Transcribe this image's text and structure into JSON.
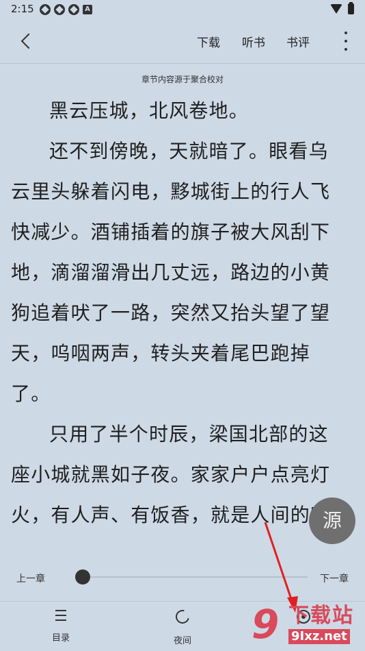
{
  "status_bar": {
    "time": "2:15",
    "notif_icon_letter": "A"
  },
  "toolbar": {
    "download_label": "下载",
    "listen_label": "听书",
    "review_label": "书评"
  },
  "source_note": "章节内容源于聚合校对",
  "content": {
    "paragraphs": [
      "黑云压城，北风卷地。",
      "还不到傍晚，天就暗了。眼看乌云里头躲着闪电，黟城街上的行人飞快减少。酒铺插着的旗子被大风刮下地，滴溜溜滑出几丈远，路边的小黄狗追着吠了一路，突然又抬头望了望天，呜咽两声，转头夹着尾巴跑掉了。",
      "只用了半个时辰，梁国北部的这座小城就黑如子夜。家家户户点亮灯火，有人声、有饭香，就是人间的味"
    ]
  },
  "source_button_label": "源",
  "progress": {
    "prev_label": "上一章",
    "next_label": "下一章",
    "value": 0
  },
  "bottom_nav": {
    "toc_label": "目录",
    "night_label": "夜间"
  },
  "watermark": {
    "logo_text": "9",
    "title": "下载站",
    "url": "9Ixz.net"
  },
  "colors": {
    "background": "#cdd9e5",
    "accent_red": "#d94a5b",
    "fab": "#6f6f6f"
  }
}
